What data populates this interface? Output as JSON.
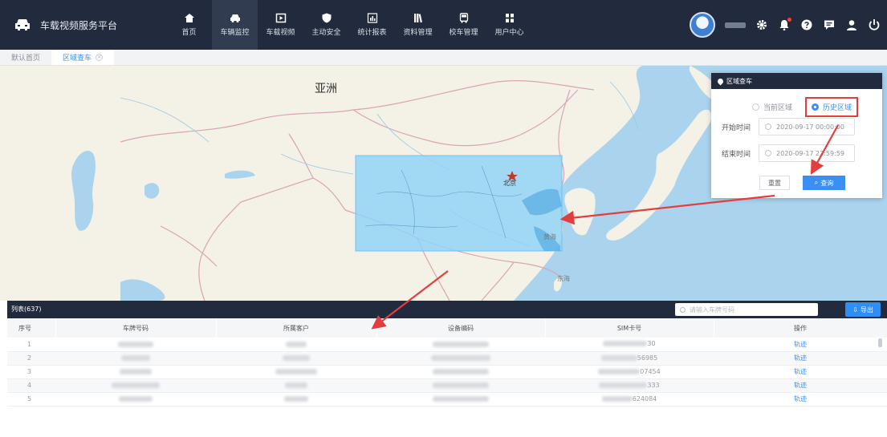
{
  "app": {
    "title": "车载视频服务平台"
  },
  "nav": [
    {
      "label": "首页",
      "icon": "home-icon",
      "active": false
    },
    {
      "label": "车辆监控",
      "icon": "car-icon",
      "active": true
    },
    {
      "label": "车载视频",
      "icon": "video-icon",
      "active": false
    },
    {
      "label": "主动安全",
      "icon": "shield-icon",
      "active": false
    },
    {
      "label": "统计报表",
      "icon": "chart-icon",
      "active": false
    },
    {
      "label": "资料管理",
      "icon": "books-icon",
      "active": false
    },
    {
      "label": "校车管理",
      "icon": "bus-icon",
      "active": false
    },
    {
      "label": "用户中心",
      "icon": "grid-icon",
      "active": false
    }
  ],
  "header_tools": [
    "settings-icon",
    "notification-icon",
    "help-icon",
    "message-icon",
    "user-icon",
    "power-icon"
  ],
  "tabs": [
    {
      "label": "默认首页",
      "active": false
    },
    {
      "label": "区域查车",
      "active": true
    }
  ],
  "map": {
    "continent_label": "亚洲",
    "city_label": "北京",
    "small_labels": [
      "黄海",
      "东海"
    ]
  },
  "panel": {
    "title": "区域查车",
    "radio_current": "当前区域",
    "radio_history": "历史区域",
    "start_label": "开始时间",
    "start_value": "2020-09-17 00:00:00",
    "end_label": "结束时间",
    "end_value": "2020-09-17 23:59:59",
    "reset": "重置",
    "query": "查询"
  },
  "list": {
    "title": "列表(637)",
    "search_placeholder": "请输入车牌号码",
    "export": "导出",
    "columns": [
      "序号",
      "车牌号码",
      "所属客户",
      "设备编码",
      "SIM卡号",
      "操作"
    ],
    "rows": [
      {
        "index": "1",
        "sim_suffix": "30",
        "action": "轨迹"
      },
      {
        "index": "2",
        "sim_suffix": "56985",
        "action": "轨迹"
      },
      {
        "index": "3",
        "sim_suffix": "07454",
        "action": "轨迹"
      },
      {
        "index": "4",
        "sim_suffix": "333",
        "action": "轨迹"
      },
      {
        "index": "5",
        "sim_suffix": "624084",
        "action": "轨迹"
      }
    ]
  },
  "colors": {
    "header_bg": "#222b3d",
    "accent": "#3b8ff3",
    "highlight": "#e33d3d",
    "selection_fill": "#8fd3f7"
  }
}
